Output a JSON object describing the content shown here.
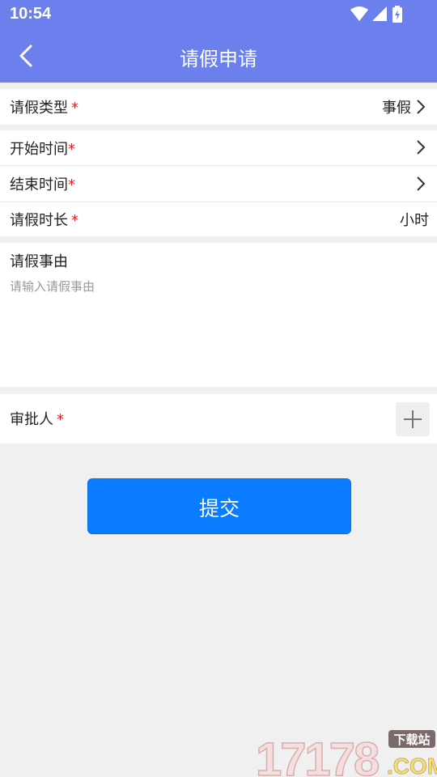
{
  "status_bar": {
    "time": "10:54"
  },
  "nav": {
    "title": "请假申请"
  },
  "form": {
    "leave_type": {
      "label": "请假类型",
      "required_mark": "*",
      "value": "事假"
    },
    "start_time": {
      "label": "开始时间",
      "required_mark": "*"
    },
    "end_time": {
      "label": "结束时间",
      "required_mark": "*"
    },
    "duration": {
      "label": "请假时长",
      "required_mark": "*",
      "unit": "小时"
    },
    "reason": {
      "label": "请假事由",
      "placeholder": "请输入请假事由"
    },
    "approver": {
      "label": "审批人",
      "required_mark": "*"
    }
  },
  "submit_label": "提交",
  "watermark": {
    "brand": "17178",
    "tag": "下载站",
    "suffix": ".COM"
  },
  "colors": {
    "header": "#6b80ec",
    "submit": "#0a7cff",
    "required": "#e02020",
    "page_bg": "#f0f0f0"
  }
}
